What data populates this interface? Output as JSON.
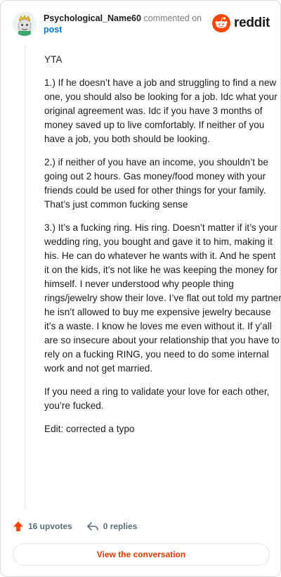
{
  "comment": {
    "username": "Psychological_Name60",
    "action": "commented on",
    "target": "post",
    "paragraphs": [
      "YTA",
      "1.) If he doesn’t have a job and struggling to find a new one, you should also be looking for a job. Idc what your original agreement was. Idc if you have 3 months of money saved up to live comfortably. If neither of you have a job, you both should be looking.",
      "2.) if neither of you have an income, you shouldn’t be going out 2 hours. Gas money/food money with your friends could be used for other things for your family. That’s just common fucking sense",
      "3.) It’s a fucking ring. His ring. Doesn’t matter if it’s your wedding ring, you bought and gave it to him, making it his. He can do whatever he wants with it. And he spent it on the kids, it’s not like he was keeping the money for himself. I never understood why people thing rings/jewelry show their love. I’ve flat out told my partner he isn’t allowed to buy me expensive jewelry because it’s a waste. I know he loves me even without it. If y’all are so insecure about your relationship that you have to rely on a fucking RING, you need to do some internal work and not get married.",
      "If you need a ring to validate your love for each other, you’re fucked.",
      "Edit: corrected a typo"
    ]
  },
  "brand": {
    "name": "reddit",
    "color": "#ff4500"
  },
  "footer": {
    "upvotes": "16 upvotes",
    "replies": "0 replies"
  },
  "cta": {
    "label": "View the conversation"
  },
  "icons": [
    "avatar",
    "reddit-logo-icon",
    "upvote-icon",
    "reply-icon"
  ]
}
